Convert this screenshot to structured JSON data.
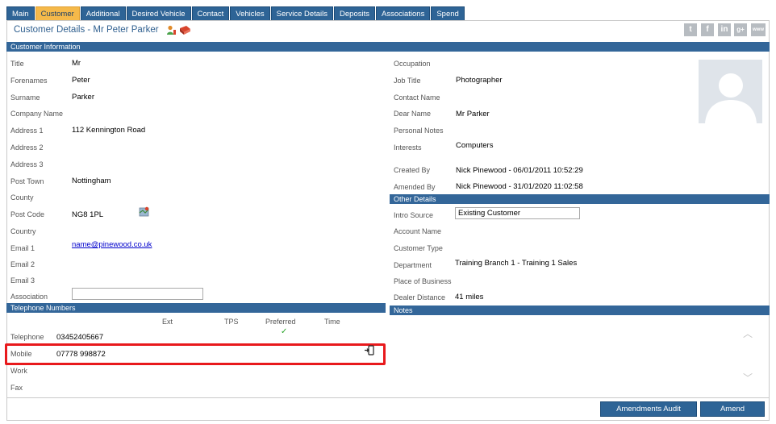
{
  "tabs": [
    {
      "label": "Main",
      "active": false
    },
    {
      "label": "Customer",
      "active": true
    },
    {
      "label": "Additional",
      "active": false
    },
    {
      "label": "Desired Vehicle",
      "active": false
    },
    {
      "label": "Contact",
      "active": false
    },
    {
      "label": "Vehicles",
      "active": false
    },
    {
      "label": "Service Details",
      "active": false
    },
    {
      "label": "Deposits",
      "active": false
    },
    {
      "label": "Associations",
      "active": false
    },
    {
      "label": "Spend",
      "active": false
    }
  ],
  "page_title": "Customer Details - Mr Peter Parker",
  "social_icons": [
    "twitter-icon",
    "facebook-icon",
    "linkedin-icon",
    "google-plus-icon",
    "web-icon"
  ],
  "sections": {
    "customer_info": "Customer Information",
    "telephone": "Telephone Numbers",
    "other_details": "Other Details",
    "notes": "Notes"
  },
  "customer": {
    "title": {
      "label": "Title",
      "value": "Mr"
    },
    "forenames": {
      "label": "Forenames",
      "value": "Peter"
    },
    "surname": {
      "label": "Surname",
      "value": "Parker"
    },
    "company_name": {
      "label": "Company Name",
      "value": ""
    },
    "address1": {
      "label": "Address 1",
      "value": "112 Kennington Road"
    },
    "address2": {
      "label": "Address 2",
      "value": ""
    },
    "address3": {
      "label": "Address 3",
      "value": ""
    },
    "post_town": {
      "label": "Post Town",
      "value": "Nottingham"
    },
    "county": {
      "label": "County",
      "value": ""
    },
    "post_code": {
      "label": "Post Code",
      "value": "NG8 1PL"
    },
    "country": {
      "label": "Country",
      "value": ""
    },
    "email1": {
      "label": "Email 1",
      "value": "name@pinewood.co.uk"
    },
    "email2": {
      "label": "Email 2",
      "value": ""
    },
    "email3": {
      "label": "Email 3",
      "value": ""
    },
    "association": {
      "label": "Association",
      "value": ""
    }
  },
  "right": {
    "occupation": {
      "label": "Occupation",
      "value": ""
    },
    "job_title": {
      "label": "Job Title",
      "value": "Photographer"
    },
    "contact_name": {
      "label": "Contact Name",
      "value": ""
    },
    "dear_name": {
      "label": "Dear Name",
      "value": "Mr Parker"
    },
    "personal_notes": {
      "label": "Personal Notes",
      "value": ""
    },
    "interests": {
      "label": "Interests",
      "value": "Computers"
    },
    "created_by": {
      "label": "Created By",
      "value": "Nick Pinewood - 06/01/2011 10:52:29"
    },
    "amended_by": {
      "label": "Amended By",
      "value": "Nick Pinewood - 31/01/2020 11:02:58"
    }
  },
  "other": {
    "intro_source": {
      "label": "Intro Source",
      "value": "Existing Customer"
    },
    "account_name": {
      "label": "Account Name",
      "value": ""
    },
    "customer_type": {
      "label": "Customer Type",
      "value": ""
    },
    "department": {
      "label": "Department",
      "value": "Training Branch 1 - Training 1 Sales"
    },
    "place_of_business": {
      "label": "Place of Business",
      "value": ""
    },
    "dealer_distance": {
      "label": "Dealer Distance",
      "value": "41 miles"
    }
  },
  "telephone": {
    "headers": {
      "ext": "Ext",
      "tps": "TPS",
      "preferred": "Preferred",
      "time": "Time"
    },
    "rows": [
      {
        "label": "Telephone",
        "value": "03452405667",
        "preferred": "✓"
      },
      {
        "label": "Mobile",
        "value": "07778 998872",
        "preferred": ""
      },
      {
        "label": "Work",
        "value": "",
        "preferred": ""
      },
      {
        "label": "Fax",
        "value": "",
        "preferred": ""
      }
    ]
  },
  "buttons": {
    "amendments_audit": "Amendments Audit",
    "amend": "Amend"
  },
  "colors": {
    "section_header": "#336699",
    "active_tab": "#f5b94a",
    "tab": "#2e6496",
    "highlight": "#e8191c",
    "preferred_check": "#2aa52a"
  }
}
